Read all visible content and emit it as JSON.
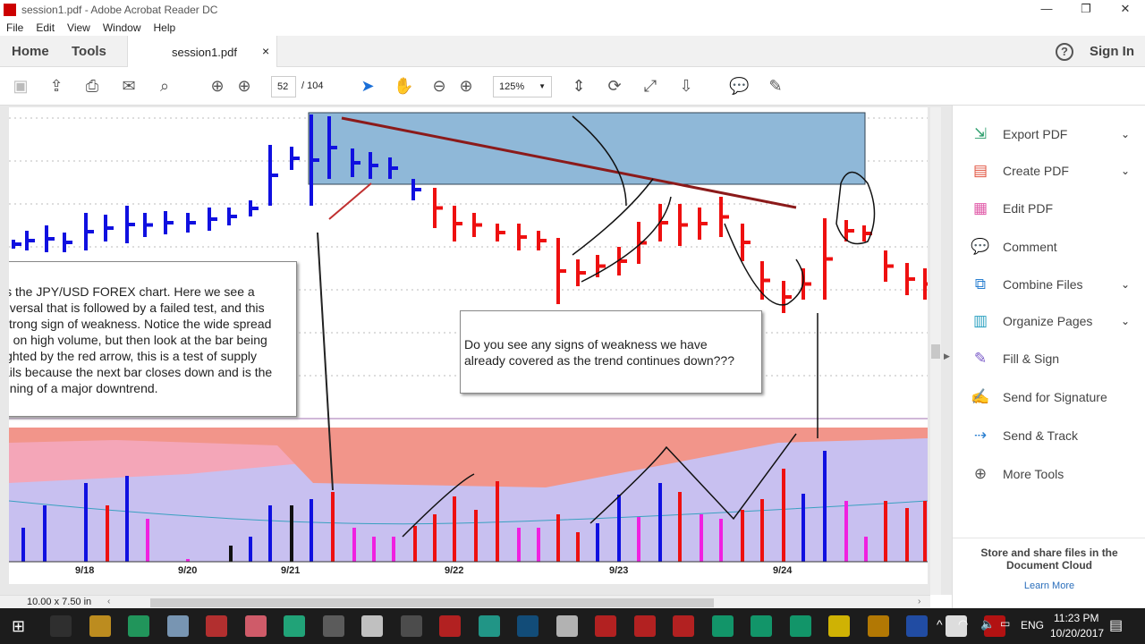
{
  "window": {
    "title": "session1.pdf - Adobe Acrobat Reader DC",
    "minimize": "—",
    "maximize": "❐",
    "close": "✕"
  },
  "menu": [
    "File",
    "Edit",
    "View",
    "Window",
    "Help"
  ],
  "tabs": {
    "home": "Home",
    "tools": "Tools",
    "document": "session1.pdf",
    "close": "×",
    "help": "?",
    "sign_in": "Sign In"
  },
  "toolbar": {
    "page_current": "52",
    "page_total": "/ 104",
    "zoom": "125%"
  },
  "document": {
    "note_left": [
      "is the JPY/USD FOREX chart. Here we see a",
      "eversal that is followed by a failed test, and this",
      "strong sign of weakness. Notice the wide spread",
      "n on high volume, but then look at the bar being",
      "ighted by the red arrow, this is a test of supply",
      "ails because the next bar closes down and is the",
      "nning of a major downtrend."
    ],
    "note_center": [
      "Do you see any signs of weakness we have",
      "already covered as the trend continues down???"
    ],
    "dates": [
      "9/18",
      "9/20",
      "9/21",
      "9/22",
      "9/23",
      "9/24"
    ],
    "colors": {
      "up_bar": "#1010e0",
      "down_bar": "#ee1010",
      "supply_zone": "#8fb8d8",
      "arrow": "#8b1a1a"
    }
  },
  "status": {
    "page_size": "10.00 x 7.50 in"
  },
  "right_panel": {
    "items": [
      {
        "label": "Export PDF",
        "icon": "export-pdf-icon",
        "color": "#2a9d6a",
        "chevron": true
      },
      {
        "label": "Create PDF",
        "icon": "create-pdf-icon",
        "color": "#e0533f",
        "chevron": true
      },
      {
        "label": "Edit PDF",
        "icon": "edit-pdf-icon",
        "color": "#e05aa8",
        "chevron": false
      },
      {
        "label": "Comment",
        "icon": "comment-icon",
        "color": "#f0b400",
        "chevron": false
      },
      {
        "label": "Combine Files",
        "icon": "combine-files-icon",
        "color": "#2a7fd0",
        "chevron": true
      },
      {
        "label": "Organize Pages",
        "icon": "organize-pages-icon",
        "color": "#2aa0c0",
        "chevron": true
      },
      {
        "label": "Fill & Sign",
        "icon": "fill-sign-icon",
        "color": "#7a5ac8",
        "chevron": false
      },
      {
        "label": "Send for Signature",
        "icon": "send-signature-icon",
        "color": "#6a5ad0",
        "chevron": false
      },
      {
        "label": "Send & Track",
        "icon": "send-track-icon",
        "color": "#2a7fd0",
        "chevron": false
      },
      {
        "label": "More Tools",
        "icon": "more-tools-icon",
        "color": "#555",
        "chevron": false
      }
    ],
    "cloud_text": "Store and share files in the Document Cloud",
    "learn_more": "Learn More"
  },
  "taskbar": {
    "time": "11:23 PM",
    "date": "10/20/2017",
    "lang": "ENG"
  }
}
